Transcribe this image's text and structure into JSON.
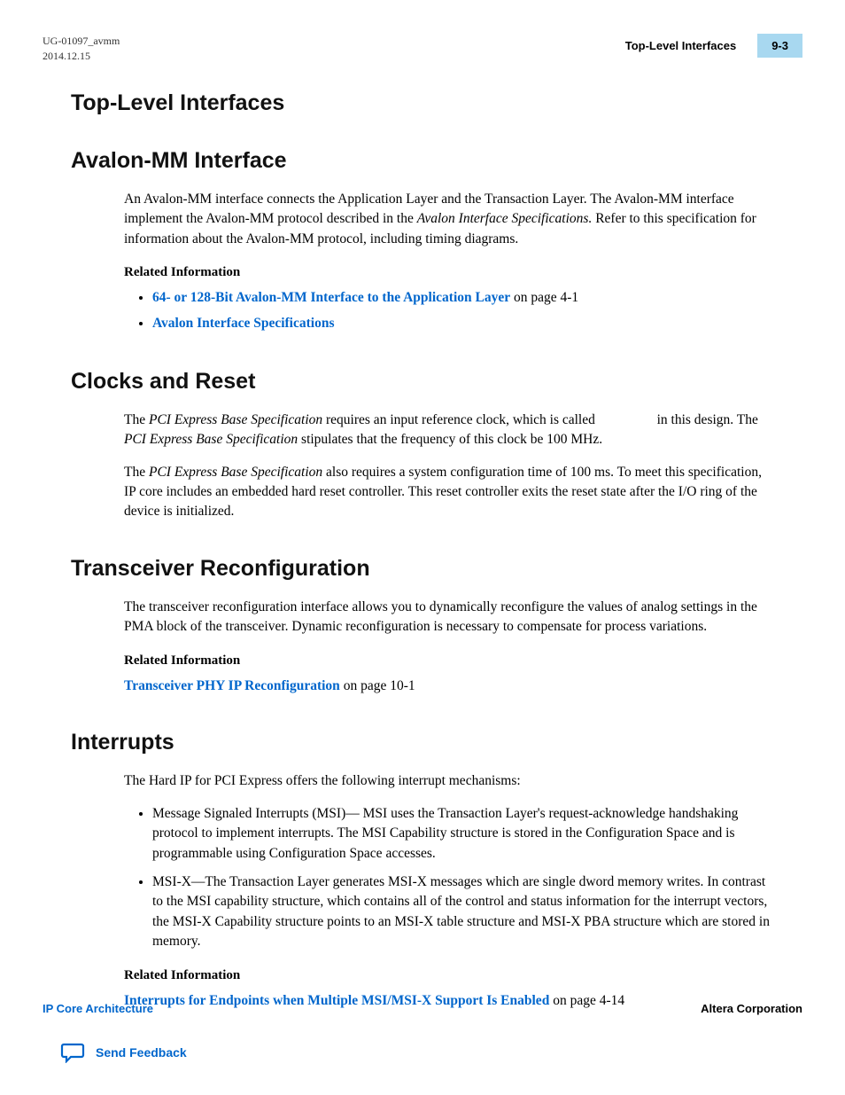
{
  "header": {
    "doc_id": "UG-01097_avmm",
    "date": "2014.12.15",
    "breadcrumb": "Top-Level Interfaces",
    "page_num": "9-3"
  },
  "sections": {
    "main_title": "Top-Level Interfaces",
    "avalon": {
      "title": "Avalon-MM Interface",
      "para_prefix": "An Avalon‑MM interface connects the Application Layer and the Transaction Layer. The Avalon-MM interface implement the Avalon-MM protocol described in the ",
      "para_italic": "Avalon Interface Specifications.",
      "para_suffix": " Refer to this specification for information about the Avalon-MM protocol, including timing diagrams.",
      "related_label": "Related Information",
      "link1": "64- or 128-Bit Avalon-MM Interface to the Application Layer",
      "link1_suffix": " on page 4-1",
      "link2": "Avalon Interface Specifications"
    },
    "clocks": {
      "title": "Clocks and Reset",
      "p1_a": "The ",
      "p1_i1": "PCI Express Base Specification",
      "p1_b": " requires an input reference clock, which is called ",
      "p1_c": " in this design. The ",
      "p1_i2": "PCI Express Base Specification",
      "p1_d": " stipulates that the frequency of this clock be 100 MHz.",
      "p2_a": "The ",
      "p2_i": "PCI Express Base Specification",
      "p2_b": " also requires a system configuration time of 100 ms. To meet this specification, IP core includes an embedded hard reset controller. This reset controller exits the reset state after the I/O ring of the device is initialized."
    },
    "transceiver": {
      "title": "Transceiver Reconfiguration",
      "para": "The transceiver reconfiguration interface allows you to dynamically reconfigure the values of analog settings in the PMA block of the transceiver. Dynamic reconfiguration is necessary to compensate for process variations.",
      "related_label": "Related Information",
      "link": "Transceiver PHY IP Reconfiguration",
      "link_suffix": " on page 10-1"
    },
    "interrupts": {
      "title": "Interrupts",
      "para": "The Hard IP for PCI Express offers the following interrupt mechanisms:",
      "b1": "Message Signaled Interrupts (MSI)— MSI uses the Transaction Layer's request‑acknowledge handshaking protocol to implement interrupts. The MSI Capability structure is stored in the Configu­ration Space and is programmable using Configuration Space accesses.",
      "b2": "MSI-X—The Transaction Layer generates MSI-X messages which are single dword memory writes. In contrast to the MSI capability structure, which contains all of the control and status information for the interrupt vectors, the MSI‑X Capability structure points to an MSI‑X table structure and MSI‑X PBA structure which are stored in memory.",
      "related_label": "Related Information",
      "link": "Interrupts for Endpoints when Multiple MSI/MSI‑X Support Is Enabled",
      "link_suffix": " on page 4-14"
    }
  },
  "footer": {
    "left": "IP Core Architecture",
    "right": "Altera Corporation",
    "feedback": "Send Feedback"
  }
}
